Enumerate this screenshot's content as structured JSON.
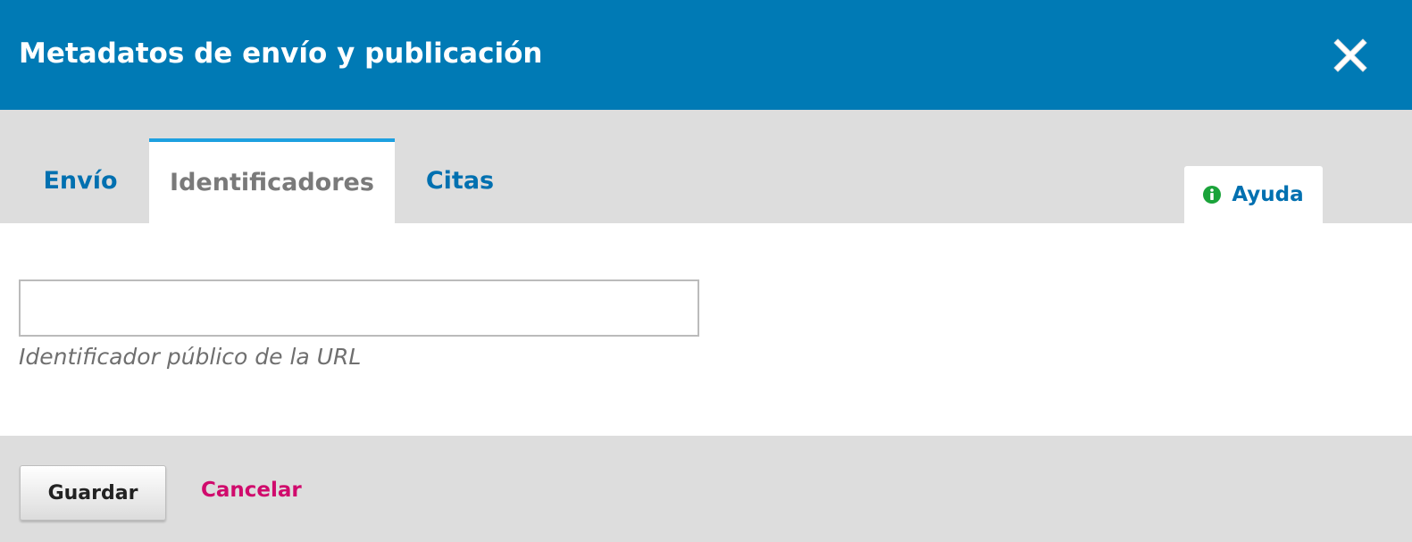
{
  "header": {
    "title": "Metadatos de envío y publicación",
    "close_icon": "close-icon"
  },
  "tabs": [
    {
      "label": "Envío",
      "active": false
    },
    {
      "label": "Identificadores",
      "active": true
    },
    {
      "label": "Citas",
      "active": false
    }
  ],
  "help": {
    "label": "Ayuda",
    "icon": "info-icon",
    "icon_color": "#1aa33a"
  },
  "form": {
    "url_field": {
      "value": "",
      "placeholder": ""
    },
    "url_help": "Identificador público de la URL"
  },
  "footer": {
    "save_label": "Guardar",
    "cancel_label": "Cancelar"
  },
  "colors": {
    "header_bg": "#007ab5",
    "tab_link": "#0070b0",
    "active_tab_border": "#1da0e0",
    "cancel": "#d00a6c"
  }
}
